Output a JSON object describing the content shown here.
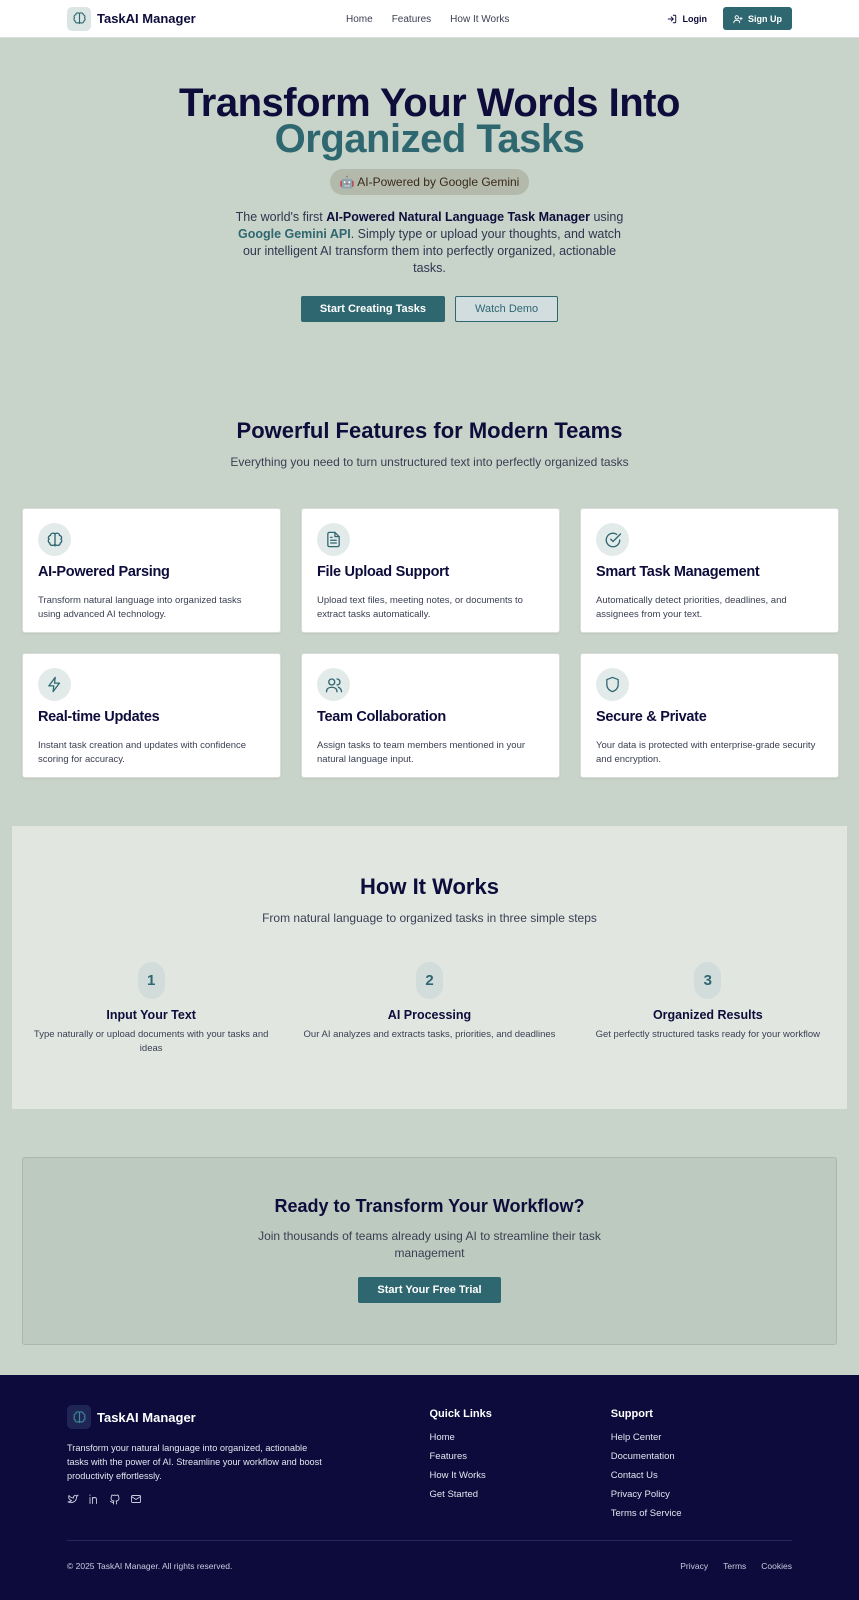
{
  "nav": {
    "brand": "TaskAI Manager",
    "links": [
      "Home",
      "Features",
      "How It Works"
    ],
    "login": "Login",
    "signup": "Sign Up"
  },
  "hero": {
    "title_line1": "Transform Your Words Into",
    "title_line2": "Organized Tasks",
    "badge": "🤖 AI-Powered by Google Gemini",
    "desc_1": "The world's first ",
    "desc_bold": "AI-Powered Natural Language Task Manager",
    "desc_2": " using ",
    "desc_api": "Google Gemini API",
    "desc_3": ". Simply type or upload your thoughts, and watch our intelligent AI transform them into perfectly organized, actionable tasks.",
    "primary_button": "Start Creating Tasks",
    "secondary_button": "Watch Demo"
  },
  "features": {
    "title": "Powerful Features for Modern Teams",
    "subtitle": "Everything you need to turn unstructured text into perfectly organized tasks",
    "cards": [
      {
        "icon": "brain-icon",
        "title": "AI-Powered Parsing",
        "desc": "Transform natural language into organized tasks using advanced AI technology."
      },
      {
        "icon": "file-text-icon",
        "title": "File Upload Support",
        "desc": "Upload text files, meeting notes, or documents to extract tasks automatically."
      },
      {
        "icon": "check-circle-icon",
        "title": "Smart Task Management",
        "desc": "Automatically detect priorities, deadlines, and assignees from your text."
      },
      {
        "icon": "lightning-icon",
        "title": "Real-time Updates",
        "desc": "Instant task creation and updates with confidence scoring for accuracy."
      },
      {
        "icon": "users-icon",
        "title": "Team Collaboration",
        "desc": "Assign tasks to team members mentioned in your natural language input."
      },
      {
        "icon": "shield-icon",
        "title": "Secure & Private",
        "desc": "Your data is protected with enterprise-grade security and encryption."
      }
    ]
  },
  "how": {
    "title": "How It Works",
    "subtitle": "From natural language to organized tasks in three simple steps",
    "steps": [
      {
        "num": "1",
        "title": "Input Your Text",
        "desc": "Type naturally or upload documents with your tasks and ideas"
      },
      {
        "num": "2",
        "title": "AI Processing",
        "desc": "Our AI analyzes and extracts tasks, priorities, and deadlines"
      },
      {
        "num": "3",
        "title": "Organized Results",
        "desc": "Get perfectly structured tasks ready for your workflow"
      }
    ]
  },
  "cta": {
    "title": "Ready to Transform Your Workflow?",
    "desc": "Join thousands of teams already using AI to streamline their task management",
    "button": "Start Your Free Trial"
  },
  "footer": {
    "brand": "TaskAI Manager",
    "desc": "Transform your natural language into organized, actionable tasks with the power of AI. Streamline your workflow and boost productivity effortlessly.",
    "socials": [
      "twitter-icon",
      "linkedin-icon",
      "github-icon",
      "mail-icon"
    ],
    "quick_title": "Quick Links",
    "quick_links": [
      "Home",
      "Features",
      "How It Works",
      "Get Started"
    ],
    "support_title": "Support",
    "support_links": [
      "Help Center",
      "Documentation",
      "Contact Us",
      "Privacy Policy",
      "Terms of Service"
    ],
    "copyright": "© 2025 TaskAI Manager. All rights reserved.",
    "legal": [
      "Privacy",
      "Terms",
      "Cookies"
    ]
  },
  "colors": {
    "accent": "#2e6770",
    "navy": "#0e0c3a",
    "background": "#c8d3c9",
    "footer": "#0c0b3c"
  }
}
